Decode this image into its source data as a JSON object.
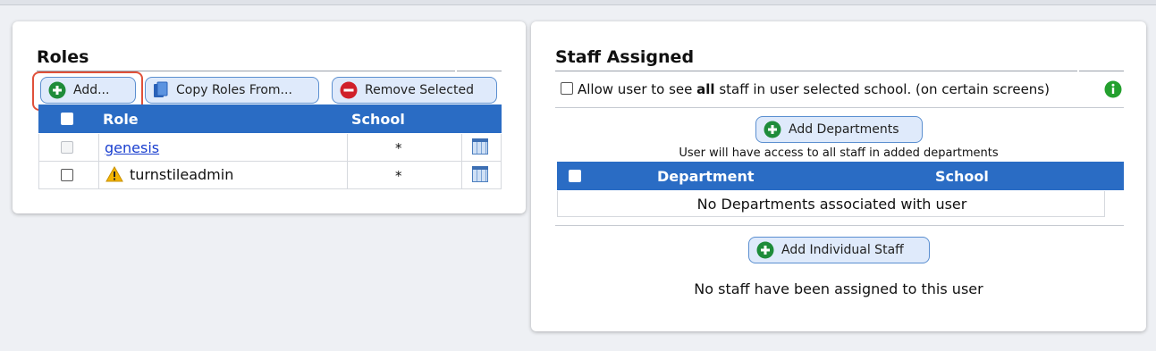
{
  "roles": {
    "title": "Roles",
    "buttons": {
      "add": "Add...",
      "copy": "Copy Roles From...",
      "remove": "Remove Selected"
    },
    "columns": {
      "role": "Role",
      "school": "School"
    },
    "rows": [
      {
        "role": "genesis",
        "school": "*",
        "link": true,
        "checkbox_disabled": true,
        "warning": false
      },
      {
        "role": "turnstileadmin",
        "school": "*",
        "link": false,
        "checkbox_disabled": false,
        "warning": true
      }
    ]
  },
  "staff": {
    "title": "Staff Assigned",
    "allow_pre": "Allow user to see ",
    "allow_bold": "all",
    "allow_post": " staff in user selected school. (on certain screens)",
    "add_departments": "Add Departments",
    "departments_note": "User will have access to all staff in added departments",
    "dept_columns": {
      "department": "Department",
      "school": "School"
    },
    "no_departments": "No Departments associated with user",
    "add_individual": "Add Individual Staff",
    "no_staff": "No staff have been assigned to this user"
  },
  "colors": {
    "header_blue": "#2a6cc4",
    "button_bg": "#dfeafb",
    "add_green": "#1e8c3a",
    "remove_red": "#d0202a",
    "highlight": "#e0513a",
    "info_green": "#24a02e"
  },
  "icons": {
    "add": "plus-circle-icon",
    "copy": "copy-icon",
    "remove": "minus-circle-icon",
    "warning": "warning-icon",
    "calendar": "calendar-icon",
    "info": "info-icon"
  }
}
